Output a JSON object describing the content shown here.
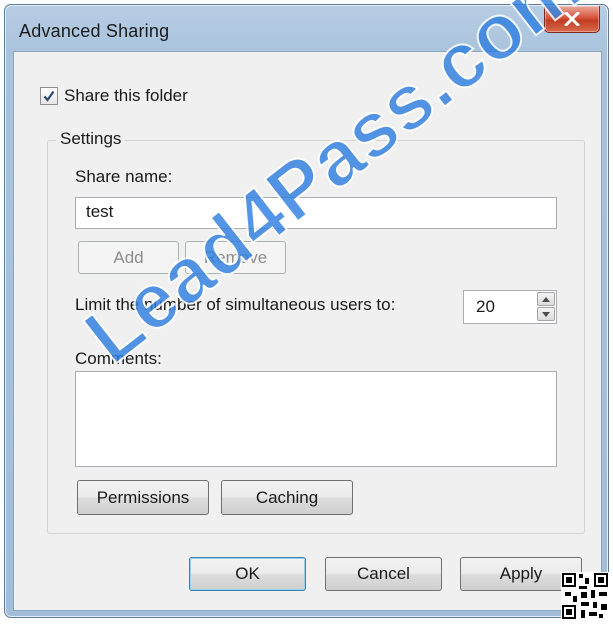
{
  "window": {
    "title": "Advanced Sharing"
  },
  "share_checkbox": {
    "label": "Share this folder",
    "checked": true
  },
  "settings": {
    "group_label": "Settings",
    "share_name_label": "Share name:",
    "share_name_value": "test",
    "add_label": "Add",
    "remove_label": "Remove",
    "limit_label": "Limit the number of simultaneous users to:",
    "limit_value": "20",
    "comments_label": "Comments:",
    "comments_value": "",
    "permissions_label": "Permissions",
    "caching_label": "Caching"
  },
  "footer": {
    "ok_label": "OK",
    "cancel_label": "Cancel",
    "apply_label": "Apply"
  },
  "watermark": {
    "text": "Lead4Pass.com"
  },
  "colors": {
    "accent": "#3c7fb1",
    "close_button": "#c8462d",
    "watermark": "#2f7fe0"
  }
}
